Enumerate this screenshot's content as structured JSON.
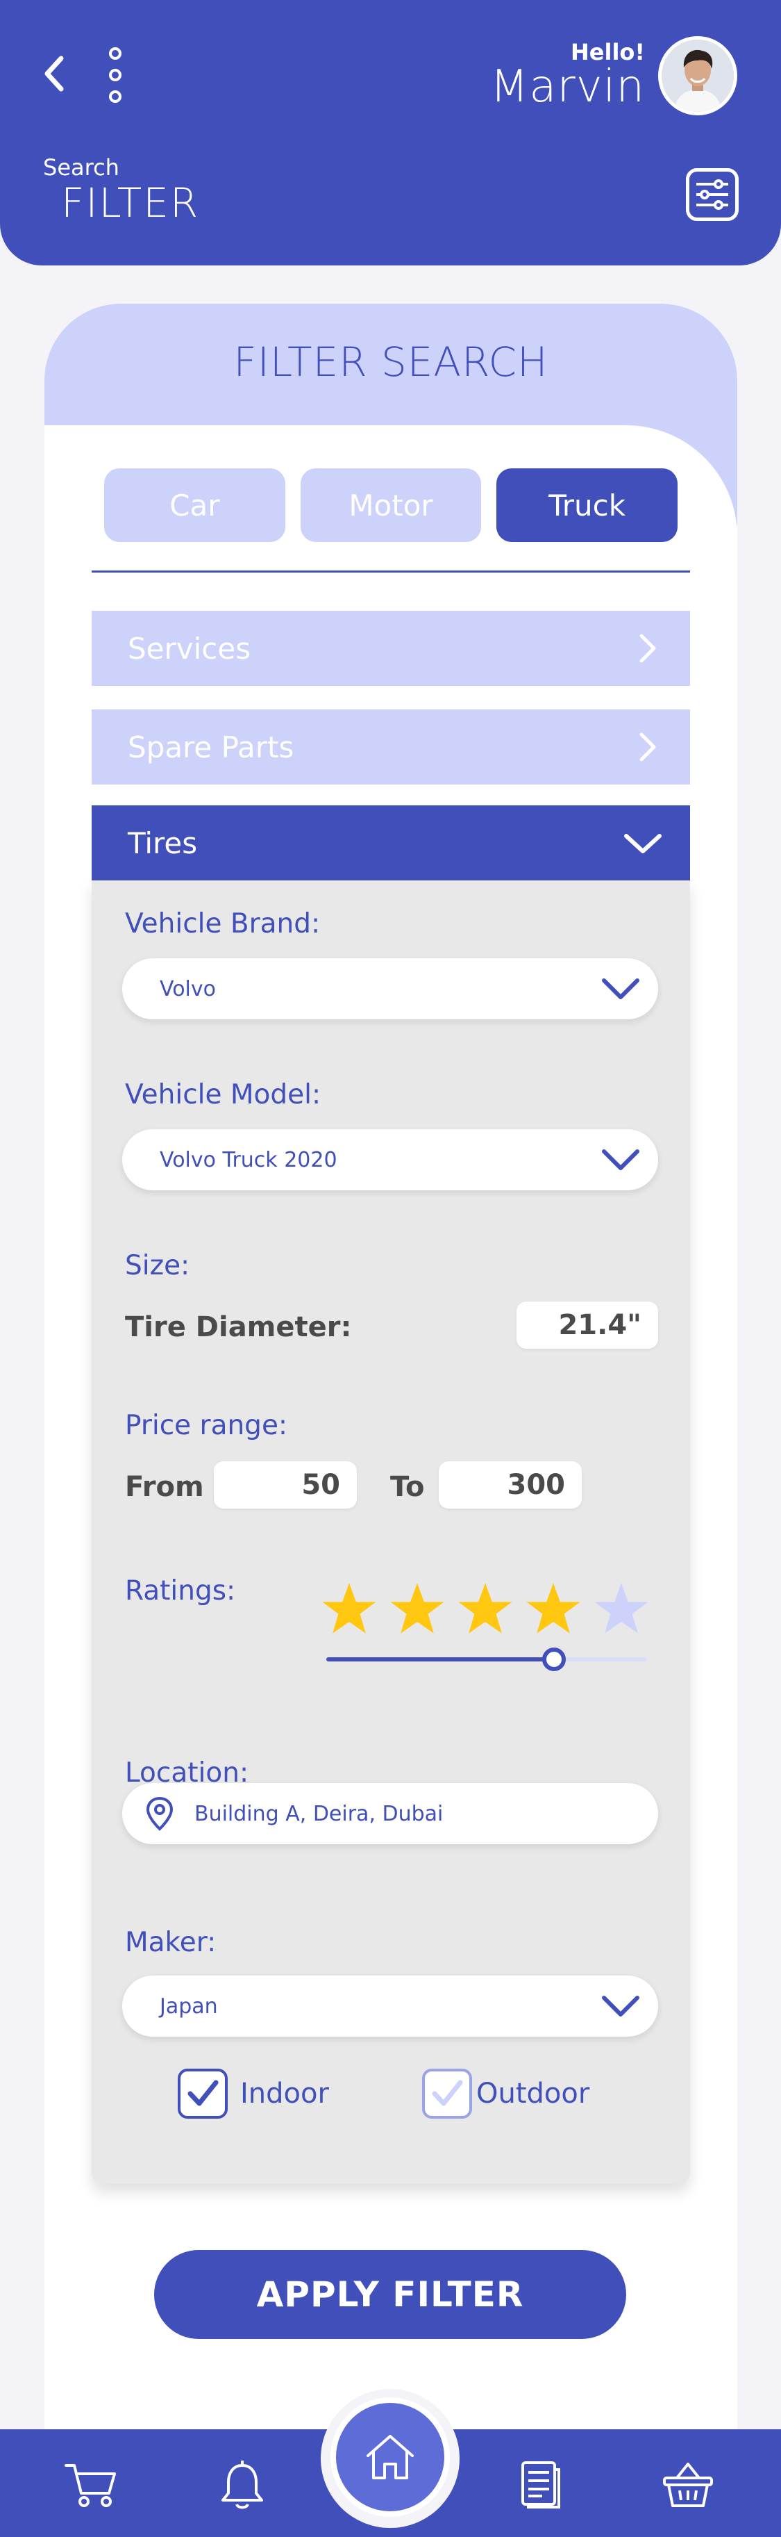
{
  "header": {
    "greeting": "Hello!",
    "user_name": "Marvin",
    "search_label": "Search",
    "page_title": "FILTER"
  },
  "card": {
    "title": "FILTER SEARCH",
    "tabs": [
      {
        "label": "Car",
        "active": false
      },
      {
        "label": "Motor",
        "active": false
      },
      {
        "label": "Truck",
        "active": true
      }
    ],
    "categories": [
      {
        "label": "Services",
        "expanded": false
      },
      {
        "label": "Spare Parts",
        "expanded": false
      },
      {
        "label": "Tires",
        "expanded": true
      }
    ]
  },
  "filters": {
    "vehicle_brand_label": "Vehicle Brand:",
    "vehicle_brand_value": "Volvo",
    "vehicle_model_label": "Vehicle Model:",
    "vehicle_model_value": "Volvo Truck 2020",
    "size_label": "Size:",
    "tire_diameter_label": "Tire Diameter:",
    "tire_diameter_value": "21.4\"",
    "price_range_label": "Price range:",
    "from_label": "From",
    "from_value": "50",
    "to_label": "To",
    "to_value": "300",
    "ratings_label": "Ratings:",
    "rating_value": 4,
    "rating_max": 5,
    "location_label": "Location:",
    "location_value": "Building A, Deira, Dubai",
    "maker_label": "Maker:",
    "maker_value": "Japan",
    "indoor_label": "Indoor",
    "indoor_checked": true,
    "outdoor_label": "Outdoor",
    "outdoor_checked": true
  },
  "apply_button_label": "APPLY FILTER",
  "nav": {
    "icons": [
      "cart-icon",
      "bell-icon",
      "home-icon",
      "document-icon",
      "basket-icon"
    ]
  },
  "colors": {
    "primary": "#404fba",
    "light": "#cdd2fb",
    "panel": "#e8e8e8",
    "star": "#ffc70f",
    "background": "#f4f4f8"
  }
}
